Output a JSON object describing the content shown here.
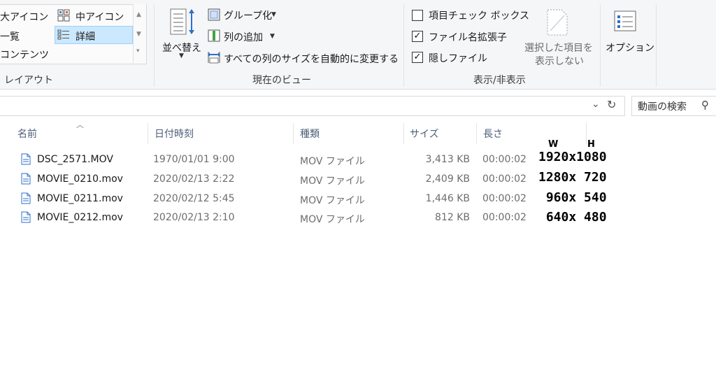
{
  "ribbon": {
    "layout": {
      "large_icons": "大アイコン",
      "medium_icons": "中アイコン",
      "list": "一覧",
      "details": "詳細",
      "content": "コンテンツ",
      "group_label": "レイアウト"
    },
    "current_view": {
      "sort_by": "並べ替え",
      "group_by": "グループ化",
      "add_columns": "列の追加",
      "size_all_columns": "すべての列のサイズを自動的に変更する",
      "group_label": "現在のビュー"
    },
    "show_hide": {
      "item_checkboxes": "項目チェック ボックス",
      "item_checkboxes_checked": false,
      "file_extensions": "ファイル名拡張子",
      "file_extensions_checked": true,
      "hidden_items": "隠しファイル",
      "hidden_items_checked": true,
      "hide_selected_line1": "選択した項目を",
      "hide_selected_line2": "表示しない",
      "group_label": "表示/非表示"
    },
    "options_label": "オプション"
  },
  "search": {
    "placeholder": "動画の検索"
  },
  "columns": {
    "name": "名前",
    "date": "日付時刻",
    "type": "種類",
    "size": "サイズ",
    "length": "長さ"
  },
  "files": [
    {
      "name": "DSC_2571.MOV",
      "date": "1970/01/01 9:00",
      "type": "MOV ファイル",
      "size": "3,413 KB",
      "length": "00:00:02"
    },
    {
      "name": "MOVIE_0210.mov",
      "date": "2020/02/13 2:22",
      "type": "MOV ファイル",
      "size": "2,409 KB",
      "length": "00:00:02"
    },
    {
      "name": "MOVIE_0211.mov",
      "date": "2020/02/12 5:45",
      "type": "MOV ファイル",
      "size": "1,446 KB",
      "length": "00:00:02"
    },
    {
      "name": "MOVIE_0212.mov",
      "date": "2020/02/13 2:10",
      "type": "MOV ファイル",
      "size": "812 KB",
      "length": "00:00:02"
    }
  ],
  "annotations": {
    "w_header": "W",
    "h_header": "H",
    "rows": [
      "1920x1080",
      "1280x 720",
      " 960x 540",
      " 640x 480"
    ]
  },
  "colors": {
    "selected_bg": "#cce8ff",
    "header_text": "#4d5f7a",
    "ribbon_bg": "#f5f6f7"
  }
}
